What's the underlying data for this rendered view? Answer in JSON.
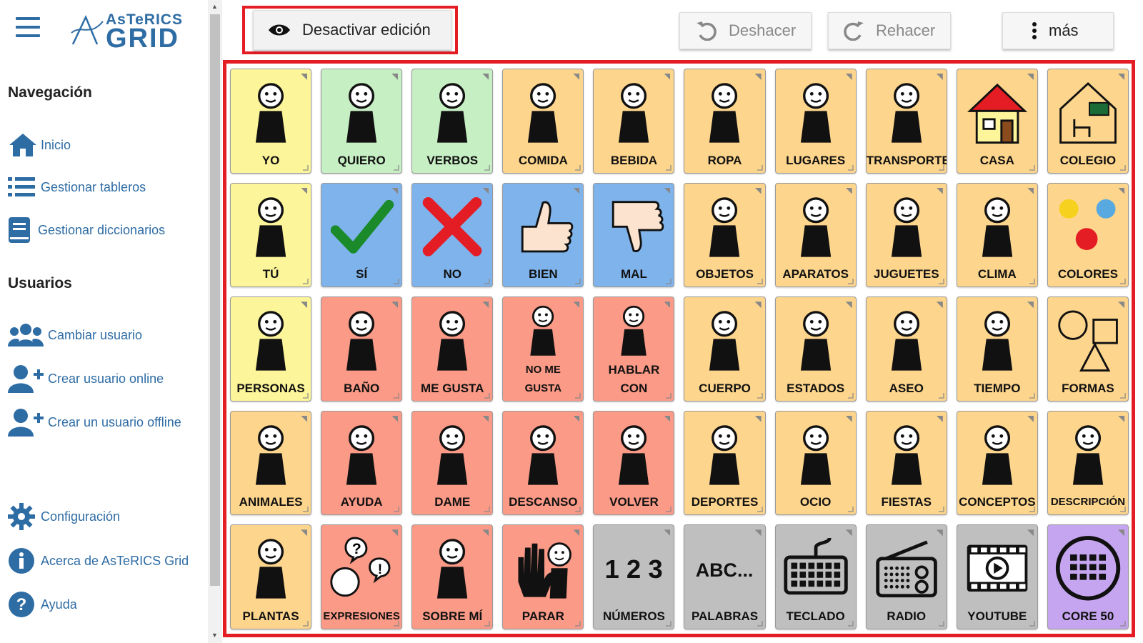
{
  "app": {
    "logo_line1": "AsTeRICS",
    "logo_line2": "GRID"
  },
  "sidebar": {
    "nav_heading": "Navegación",
    "nav_items": [
      {
        "label": "Inicio",
        "icon": "home-icon"
      },
      {
        "label": "Gestionar tableros",
        "icon": "list-icon"
      },
      {
        "label": "Gestionar diccionarios",
        "icon": "dictionary-icon"
      }
    ],
    "users_heading": "Usuarios",
    "user_items": [
      {
        "label": "Cambiar usuario",
        "icon": "users-icon"
      },
      {
        "label": "Crear usuario online",
        "icon": "user-plus-icon"
      },
      {
        "label": "Crear un usuario offline",
        "icon": "user-plus-icon"
      }
    ],
    "bottom_items": [
      {
        "label": "Configuración",
        "icon": "gear-icon"
      },
      {
        "label": "Acerca de AsTeRICS Grid",
        "icon": "info-icon"
      },
      {
        "label": "Ayuda",
        "icon": "help-icon"
      }
    ]
  },
  "toolbar": {
    "edit_toggle_label": "Desactivar edición",
    "undo_label": "Deshacer",
    "redo_label": "Rehacer",
    "more_label": "más"
  },
  "colors": {
    "accent": "#2e6ca4",
    "highlight_frame": "#e41c24",
    "yellow": "#fdf59a",
    "green": "#c7efc4",
    "orange": "#fdd58c",
    "blue": "#7fb3ec",
    "red": "#fb9a87",
    "gray": "#bfbfbf",
    "purple": "#c5a5ef"
  },
  "grid": {
    "cells": [
      {
        "label": "YO",
        "color": "yellow",
        "icon": "person-me-icon"
      },
      {
        "label": "QUIERO",
        "color": "green",
        "icon": "hand-want-icon"
      },
      {
        "label": "VERBOS",
        "color": "green",
        "icon": "verbs-icon"
      },
      {
        "label": "COMIDA",
        "color": "orange",
        "icon": "food-icon"
      },
      {
        "label": "BEBIDA",
        "color": "orange",
        "icon": "drink-icon"
      },
      {
        "label": "ROPA",
        "color": "orange",
        "icon": "clothes-icon"
      },
      {
        "label": "LUGARES",
        "color": "orange",
        "icon": "places-icon"
      },
      {
        "label": "TRANSPORTE",
        "color": "orange",
        "icon": "transport-icon"
      },
      {
        "label": "CASA",
        "color": "orange",
        "icon": "house-icon"
      },
      {
        "label": "COLEGIO",
        "color": "orange",
        "icon": "school-icon"
      },
      {
        "label": "TÚ",
        "color": "yellow",
        "icon": "person-you-icon"
      },
      {
        "label": "SÍ",
        "color": "blue",
        "icon": "check-icon"
      },
      {
        "label": "NO",
        "color": "blue",
        "icon": "cross-icon"
      },
      {
        "label": "BIEN",
        "color": "blue",
        "icon": "thumb-up-icon"
      },
      {
        "label": "MAL",
        "color": "blue",
        "icon": "thumb-down-icon"
      },
      {
        "label": "OBJETOS",
        "color": "orange",
        "icon": "objects-icon"
      },
      {
        "label": "APARATOS",
        "color": "orange",
        "icon": "devices-icon"
      },
      {
        "label": "JUGUETES",
        "color": "orange",
        "icon": "toys-icon"
      },
      {
        "label": "CLIMA",
        "color": "orange",
        "icon": "weather-icon"
      },
      {
        "label": "COLORES",
        "color": "orange",
        "icon": "colors-icon"
      },
      {
        "label": "PERSONAS",
        "color": "yellow",
        "icon": "people-icon"
      },
      {
        "label": "BAÑO",
        "color": "red",
        "icon": "toilet-icon"
      },
      {
        "label": "ME GUSTA",
        "color": "red",
        "icon": "like-icon"
      },
      {
        "label": "NO ME GUSTA",
        "color": "red",
        "icon": "dislike-icon"
      },
      {
        "label": "HABLAR CON",
        "color": "red",
        "icon": "talk-icon"
      },
      {
        "label": "CUERPO",
        "color": "orange",
        "icon": "body-icon"
      },
      {
        "label": "ESTADOS",
        "color": "orange",
        "icon": "feelings-icon"
      },
      {
        "label": "ASEO",
        "color": "orange",
        "icon": "hygiene-icon"
      },
      {
        "label": "TIEMPO",
        "color": "orange",
        "icon": "time-icon"
      },
      {
        "label": "FORMAS",
        "color": "orange",
        "icon": "shapes-icon"
      },
      {
        "label": "ANIMALES",
        "color": "orange",
        "icon": "animals-icon"
      },
      {
        "label": "AYUDA",
        "color": "red",
        "icon": "help-hands-icon"
      },
      {
        "label": "DAME",
        "color": "red",
        "icon": "give-me-icon"
      },
      {
        "label": "DESCANSO",
        "color": "red",
        "icon": "rest-icon"
      },
      {
        "label": "VOLVER",
        "color": "red",
        "icon": "return-icon"
      },
      {
        "label": "DEPORTES",
        "color": "orange",
        "icon": "sports-icon"
      },
      {
        "label": "OCIO",
        "color": "orange",
        "icon": "leisure-icon"
      },
      {
        "label": "FIESTAS",
        "color": "orange",
        "icon": "party-icon"
      },
      {
        "label": "CONCEPTOS",
        "color": "orange",
        "icon": "concepts-icon"
      },
      {
        "label": "DESCRIPCIÓN",
        "color": "orange",
        "icon": "description-icon"
      },
      {
        "label": "PLANTAS",
        "color": "orange",
        "icon": "plants-icon"
      },
      {
        "label": "EXPRESIONES",
        "color": "red",
        "icon": "expressions-icon"
      },
      {
        "label": "SOBRE MÍ",
        "color": "red",
        "icon": "about-me-icon"
      },
      {
        "label": "PARAR",
        "color": "red",
        "icon": "stop-icon"
      },
      {
        "label": "NÚMEROS",
        "color": "gray",
        "icon": "numbers-icon",
        "glyph": "1 2 3"
      },
      {
        "label": "PALABRAS",
        "color": "gray",
        "icon": "words-icon",
        "glyph": "ABC..."
      },
      {
        "label": "TECLADO",
        "color": "gray",
        "icon": "keyboard-icon"
      },
      {
        "label": "RADIO",
        "color": "gray",
        "icon": "radio-icon"
      },
      {
        "label": "YOUTUBE",
        "color": "gray",
        "icon": "youtube-icon"
      },
      {
        "label": "CORE 50",
        "color": "purple",
        "icon": "core-grid-icon"
      }
    ]
  }
}
